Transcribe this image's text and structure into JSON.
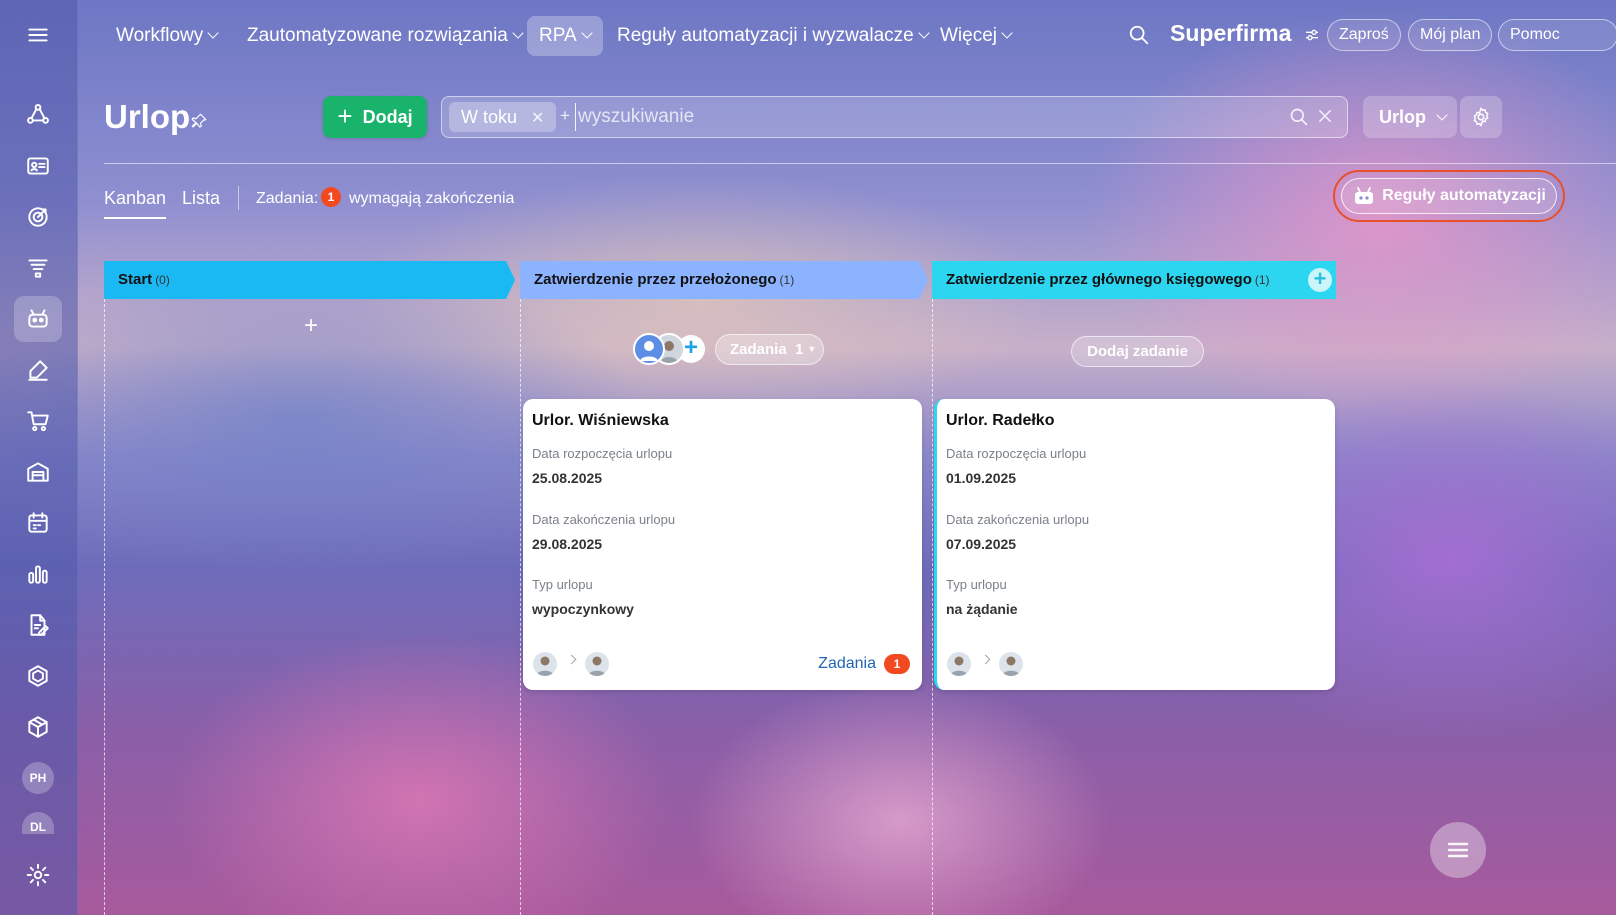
{
  "top_nav": {
    "items": [
      {
        "label": "Workflowy"
      },
      {
        "label": "Zautomatyzowane rozwiązania"
      },
      {
        "label": "RPA"
      },
      {
        "label": "Reguły automatyzacji i wyzwalacze"
      },
      {
        "label": "Więcej"
      }
    ],
    "brand": "Superfirma",
    "invite": "Zaproś",
    "my_plan": "Mój plan",
    "help": "Pomoc"
  },
  "sidebar": {
    "items": [
      {
        "icon": "menu-icon"
      },
      {
        "icon": "workflow-icon"
      },
      {
        "icon": "crm-card-icon"
      },
      {
        "icon": "target-icon"
      },
      {
        "icon": "filter-funnel-icon"
      },
      {
        "icon": "robot-icon",
        "active": true
      },
      {
        "icon": "sign-pen-icon"
      },
      {
        "icon": "cart-icon"
      },
      {
        "icon": "warehouse-icon"
      },
      {
        "icon": "calendar-icon"
      },
      {
        "icon": "analytics-icon"
      },
      {
        "icon": "document-edit-icon"
      },
      {
        "icon": "hexagon-icon"
      },
      {
        "icon": "box-icon"
      },
      {
        "icon": "settings-icon"
      }
    ],
    "avatars": [
      "PH",
      "DL"
    ]
  },
  "header": {
    "title": "Urlop",
    "add_button": "Dodaj",
    "filter_tag": "W toku",
    "search_placeholder": "wyszukiwanie",
    "type_dropdown": "Urlop"
  },
  "toolbar": {
    "tab_kanban": "Kanban",
    "tab_list": "Lista",
    "tasks_label": "Zadania:",
    "tasks_count": "1",
    "tasks_text": "wymagają zakończenia",
    "automation_button": "Reguły automatyzacji"
  },
  "columns": [
    {
      "title": "Start",
      "count": "(0)",
      "color": "#1ab9f4"
    },
    {
      "title": "Zatwierdzenie przez przełożonego",
      "count": "(1)",
      "color": "#8cb3ff"
    },
    {
      "title": "Zatwierdzenie przez głównego księgowego",
      "count": "(1)",
      "color": "#2cd5f0"
    }
  ],
  "column_actions": {
    "tasks_pill": "Zadania",
    "tasks_pill_count": "1",
    "add_task": "Dodaj zadanie"
  },
  "cards": [
    {
      "title": "Urlor. Wiśniewska",
      "start_label": "Data rozpoczęcia urlopu",
      "start_value": "25.08.2025",
      "end_label": "Data zakończenia urlopu",
      "end_value": "29.08.2025",
      "type_label": "Typ urlopu",
      "type_value": "wypoczynkowy",
      "tasks_link": "Zadania",
      "tasks_count": "1"
    },
    {
      "title": "Urlor. Radełko",
      "start_label": "Data rozpoczęcia urlopu",
      "start_value": "01.09.2025",
      "end_label": "Data zakończenia urlopu",
      "end_value": "07.09.2025",
      "type_label": "Typ urlopu",
      "type_value": "na żądanie"
    }
  ]
}
